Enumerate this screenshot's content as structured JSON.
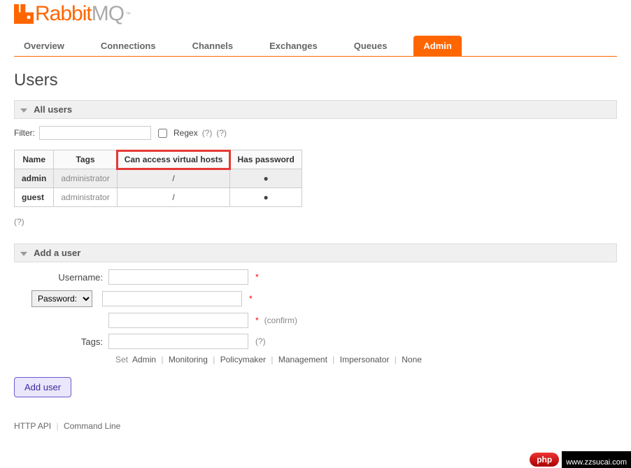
{
  "brand": {
    "rabbit": "Rabbit",
    "mq": "MQ",
    "tm": "™"
  },
  "tabs": {
    "overview": "Overview",
    "connections": "Connections",
    "channels": "Channels",
    "exchanges": "Exchanges",
    "queues": "Queues",
    "admin": "Admin"
  },
  "page_title": "Users",
  "sections": {
    "all_users": "All users",
    "add_user": "Add a user"
  },
  "filter": {
    "label": "Filter:",
    "regex_label": "Regex",
    "help1": "(?)",
    "help2": "(?)"
  },
  "users_table": {
    "headers": {
      "name": "Name",
      "tags": "Tags",
      "vhosts": "Can access virtual hosts",
      "has_pw": "Has password"
    },
    "rows": [
      {
        "name": "admin",
        "tags": "administrator",
        "vhosts": "/",
        "has_pw": "●",
        "selected": true
      },
      {
        "name": "guest",
        "tags": "administrator",
        "vhosts": "/",
        "has_pw": "●",
        "selected": false
      }
    ]
  },
  "help_q": "(?)",
  "add_user": {
    "username_label": "Username:",
    "password_option": "Password:",
    "confirm_label": "(confirm)",
    "tags_label": "Tags:",
    "tags_help": "(?)",
    "star": "*",
    "set_line": {
      "prefix": "Set",
      "admin": "Admin",
      "monitoring": "Monitoring",
      "policymaker": "Policymaker",
      "management": "Management",
      "impersonator": "Impersonator",
      "none": "None"
    },
    "button": "Add user"
  },
  "footer": {
    "http_api": "HTTP API",
    "cli": "Command Line"
  },
  "watermark": {
    "badge": "php",
    "url": "www.zzsucai.com"
  }
}
